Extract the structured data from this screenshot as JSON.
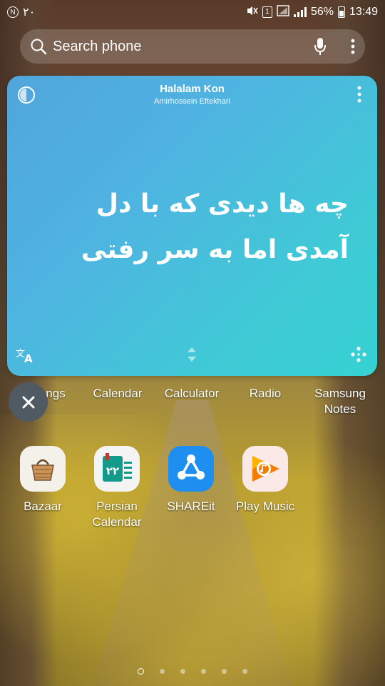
{
  "status_bar": {
    "left_indicator": "٢٠",
    "sim_badge": "1",
    "battery_percent": "56%",
    "time": "13:49"
  },
  "search": {
    "placeholder": "Search phone"
  },
  "widget": {
    "song_title": "Halalam Kon",
    "artist": "Amirhossein Eftekhari",
    "lyrics": [
      "چه ها دیدی که با دل",
      "آمدی اما به سر رفتی"
    ]
  },
  "apps_row1": [
    "ngs",
    "Calendar",
    "Calculator",
    "Radio",
    "Samsung Notes"
  ],
  "apps_row2": [
    {
      "name": "Bazaar",
      "icon": "basket-icon",
      "color": "#f4f1ea"
    },
    {
      "name": "Persian Calendar",
      "icon": "calendar-icon",
      "color": "#f4f4f4"
    },
    {
      "name": "SHAREit",
      "icon": "share-icon",
      "color": "#1f8ef1"
    },
    {
      "name": "Play Music",
      "icon": "play-music-icon",
      "color": "#fbe9e7"
    }
  ],
  "persian_calendar_badge": "٢٢",
  "pages": {
    "count": 6,
    "current": 1
  }
}
